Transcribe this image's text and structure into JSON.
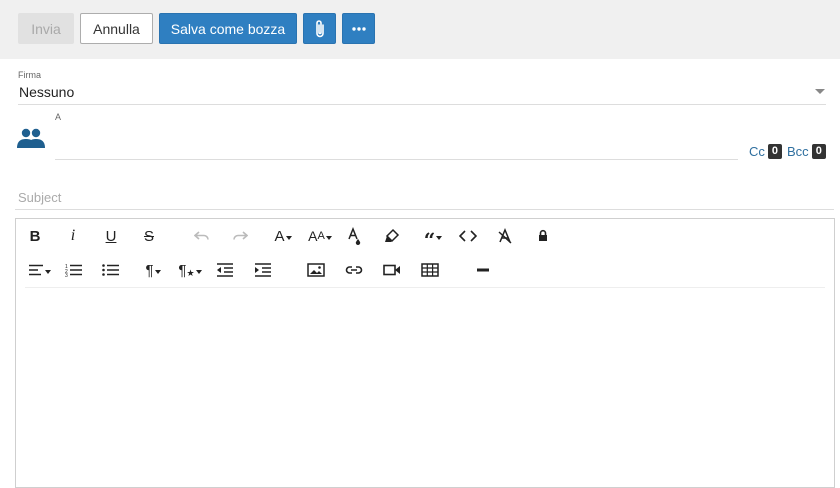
{
  "toolbar": {
    "send_label": "Invia",
    "cancel_label": "Annulla",
    "draft_label": "Salva come bozza"
  },
  "signature": {
    "label": "Firma",
    "value": "Nessuno"
  },
  "recipients": {
    "to_label": "A",
    "cc_label": "Cc",
    "cc_count": "0",
    "bcc_label": "Bcc",
    "bcc_count": "0"
  },
  "subject": {
    "placeholder": "Subject",
    "value": ""
  },
  "colors": {
    "primary": "#2f7fc1",
    "contacts_icon": "#1f5f8f",
    "toolbar_bg": "#f0f0f0"
  },
  "editor": {
    "row1": [
      "bold-icon",
      "italic-icon",
      "underline-icon",
      "strikethrough-icon",
      "undo-icon",
      "redo-icon",
      "font-family-icon",
      "font-size-icon",
      "text-color-icon",
      "highlight-icon",
      "quote-icon",
      "code-icon",
      "clear-format-icon",
      "lock-icon"
    ],
    "row2": [
      "align-icon",
      "ordered-list-icon",
      "unordered-list-icon",
      "paragraph-icon",
      "paragraph-style-icon",
      "outdent-icon",
      "indent-icon",
      "image-icon",
      "link-icon",
      "video-icon",
      "table-icon",
      "horizontal-line-icon"
    ]
  }
}
